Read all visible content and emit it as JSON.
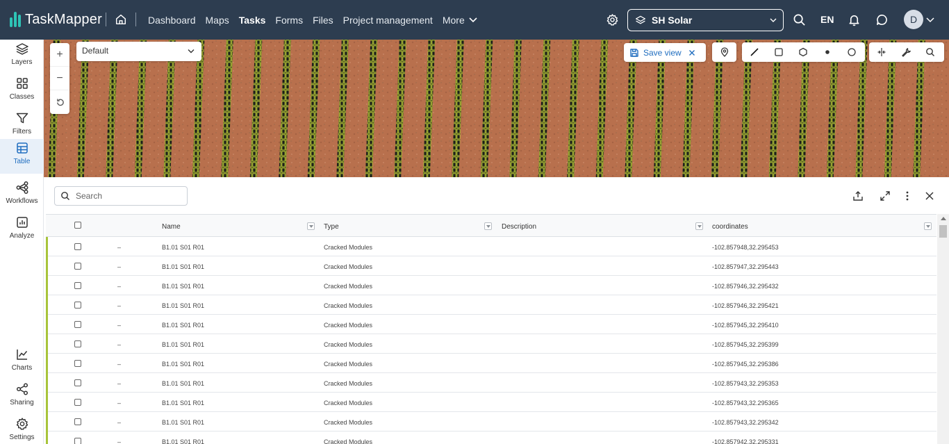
{
  "app": {
    "name": "TaskMapper"
  },
  "nav": {
    "items": [
      {
        "label": "Dashboard",
        "active": false
      },
      {
        "label": "Maps",
        "active": false
      },
      {
        "label": "Tasks",
        "active": true
      },
      {
        "label": "Forms",
        "active": false
      },
      {
        "label": "Files",
        "active": false
      },
      {
        "label": "Project management",
        "active": false
      }
    ],
    "more_label": "More"
  },
  "project": {
    "name": "SH Solar"
  },
  "language": "EN",
  "user": {
    "initial": "D"
  },
  "sidebar": {
    "items": [
      {
        "label": "Layers",
        "icon": "layers-icon"
      },
      {
        "label": "Classes",
        "icon": "grid-icon"
      },
      {
        "label": "Filters",
        "icon": "filter-icon"
      },
      {
        "label": "Table",
        "icon": "table-icon",
        "active": true
      },
      {
        "label": "Workflows",
        "icon": "workflow-icon"
      },
      {
        "label": "Analyze",
        "icon": "analyze-icon"
      }
    ],
    "bottom_items": [
      {
        "label": "Charts",
        "icon": "chart-icon"
      },
      {
        "label": "Sharing",
        "icon": "share-icon"
      },
      {
        "label": "Settings",
        "icon": "gear-icon"
      }
    ]
  },
  "map": {
    "view_select": "Default",
    "save_view_label": "Save view",
    "zoom_in": "+",
    "zoom_out": "−"
  },
  "table": {
    "search_placeholder": "Search",
    "columns": [
      "Name",
      "Type",
      "Description",
      "coordinates"
    ],
    "rows": [
      {
        "marker": "–",
        "name": "B1.01 S01 R01",
        "type": "Cracked Modules",
        "description": "",
        "coordinates": "-102.857948,32.295453"
      },
      {
        "marker": "–",
        "name": "B1.01 S01 R01",
        "type": "Cracked Modules",
        "description": "",
        "coordinates": "-102.857947,32.295443"
      },
      {
        "marker": "–",
        "name": "B1.01 S01 R01",
        "type": "Cracked Modules",
        "description": "",
        "coordinates": "-102.857946,32.295432"
      },
      {
        "marker": "–",
        "name": "B1.01 S01 R01",
        "type": "Cracked Modules",
        "description": "",
        "coordinates": "-102.857946,32.295421"
      },
      {
        "marker": "–",
        "name": "B1.01 S01 R01",
        "type": "Cracked Modules",
        "description": "",
        "coordinates": "-102.857945,32.295410"
      },
      {
        "marker": "–",
        "name": "B1.01 S01 R01",
        "type": "Cracked Modules",
        "description": "",
        "coordinates": "-102.857945,32.295399"
      },
      {
        "marker": "–",
        "name": "B1.01 S01 R01",
        "type": "Cracked Modules",
        "description": "",
        "coordinates": "-102.857945,32.295386"
      },
      {
        "marker": "–",
        "name": "B1.01 S01 R01",
        "type": "Cracked Modules",
        "description": "",
        "coordinates": "-102.857943,32.295353"
      },
      {
        "marker": "–",
        "name": "B1.01 S01 R01",
        "type": "Cracked Modules",
        "description": "",
        "coordinates": "-102.857943,32.295365"
      },
      {
        "marker": "–",
        "name": "B1.01 S01 R01",
        "type": "Cracked Modules",
        "description": "",
        "coordinates": "-102.857943,32.295342"
      },
      {
        "marker": "–",
        "name": "B1.01 S01 R01",
        "type": "Cracked Modules",
        "description": "",
        "coordinates": "-102.857942,32.295331"
      }
    ]
  },
  "colors": {
    "topbar": "#2d3d50",
    "accent": "#1f6dbf",
    "logo": "#2ec4b6",
    "row_marker": "#a8c43a"
  }
}
